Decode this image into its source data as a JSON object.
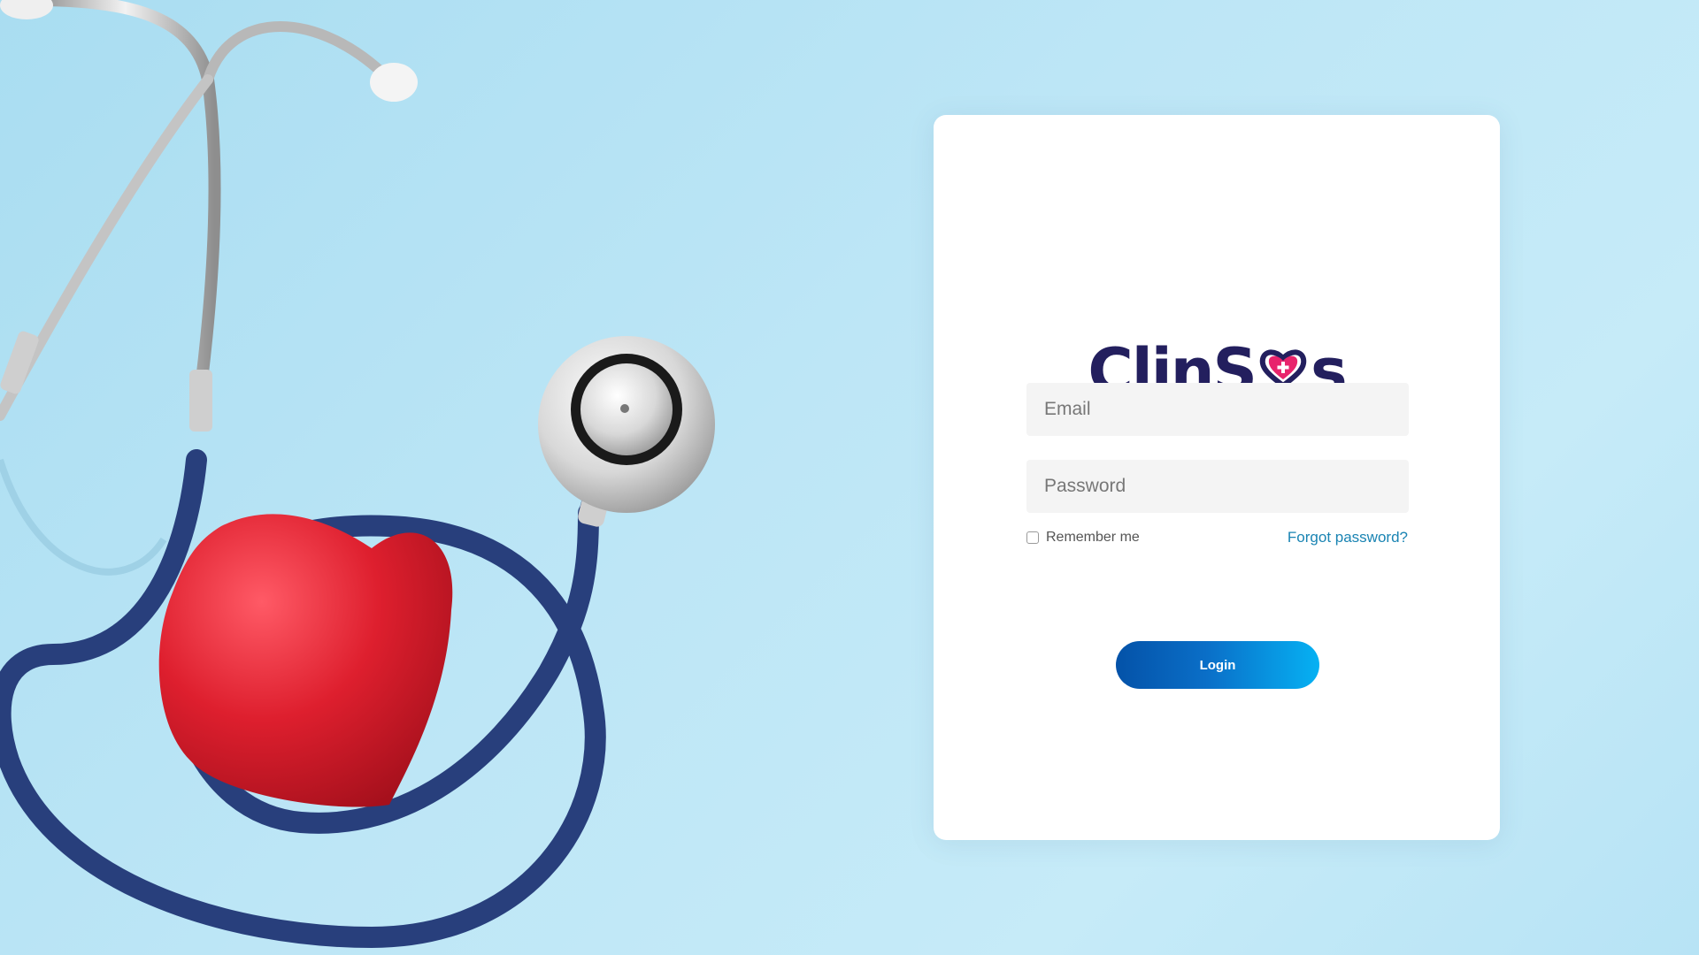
{
  "brand": {
    "name_part1": "ClinS",
    "name_part2": "s",
    "primary_color": "#231f5e",
    "accent_color": "#e8246c"
  },
  "login_form": {
    "email_placeholder": "Email",
    "password_placeholder": "Password",
    "remember_label": "Remember me",
    "forgot_label": "Forgot password?",
    "login_label": "Login",
    "login_gradient": [
      "#0452a8",
      "#06b1f3"
    ]
  },
  "background": {
    "color": "#bde6f6",
    "illustration": "stethoscope-with-red-heart"
  }
}
